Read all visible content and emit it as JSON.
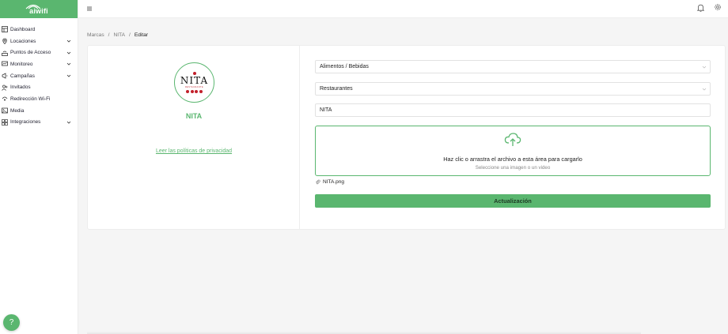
{
  "brand": {
    "logo_text": "aiwifi",
    "accent": "#5ab66f"
  },
  "sidebar": {
    "items": [
      {
        "label": "Dashboard",
        "icon": "dashboard-icon",
        "expandable": false
      },
      {
        "label": "Locaciones",
        "icon": "location-pin-icon",
        "expandable": true
      },
      {
        "label": "Puntos de Acceso",
        "icon": "access-point-icon",
        "expandable": true
      },
      {
        "label": "Monitoreo",
        "icon": "monitor-icon",
        "expandable": true
      },
      {
        "label": "Campañas",
        "icon": "megaphone-icon",
        "expandable": true
      },
      {
        "label": "Invitados",
        "icon": "users-icon",
        "expandable": false
      },
      {
        "label": "Redirección Wi-Fi",
        "icon": "redirect-icon",
        "expandable": false
      },
      {
        "label": "Media",
        "icon": "media-icon",
        "expandable": false
      },
      {
        "label": "Integraciones",
        "icon": "integrations-icon",
        "expandable": true
      }
    ],
    "help_label": "?"
  },
  "breadcrumb": {
    "items": [
      "Marcas",
      "NITA",
      "Editar"
    ],
    "separator": "/"
  },
  "profile": {
    "logo_name": "NITA",
    "logo_sub": "RESTAURANTE",
    "brand_name": "NITA",
    "privacy_link": "Leer las políticas de privacidad"
  },
  "form": {
    "category": "Alimentos / Bebidas",
    "subcategory": "Restaurantes",
    "name": "NITA",
    "dropzone_title": "Haz clic o arrastra el archivo a esta área para cargarlo",
    "dropzone_subtitle": "Seleccione una imagen o un video",
    "file_name": "NITA.png",
    "submit_label": "Actualización"
  }
}
